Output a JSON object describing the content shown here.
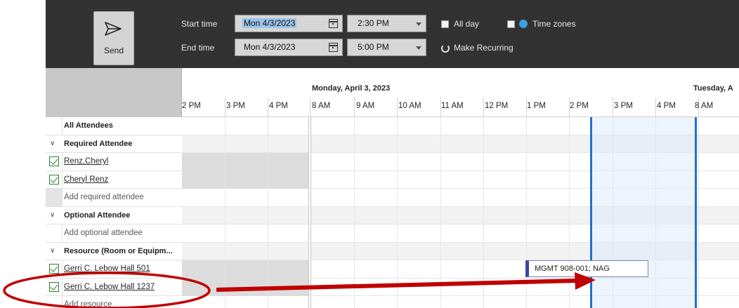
{
  "toolbar": {
    "send_label": "Send",
    "start_label": "Start time",
    "end_label": "End time",
    "start_date": "Mon 4/3/2023",
    "end_date": "Mon 4/3/2023",
    "start_time": "2:30 PM",
    "end_time": "5:00 PM",
    "all_day_label": "All day",
    "time_zones_label": "Time zones",
    "recurring_label": "Make Recurring"
  },
  "timeline": {
    "day1": "Monday, April 3, 2023",
    "day2": "Tuesday, A",
    "hours": [
      "2 PM",
      "3 PM",
      "4 PM",
      "8 AM",
      "9 AM",
      "10 AM",
      "11 AM",
      "12 PM",
      "1 PM",
      "2 PM",
      "3 PM",
      "4 PM",
      "8 AM"
    ]
  },
  "attendees": {
    "all": "All Attendees",
    "required_header": "Required Attendee",
    "required": [
      "Renz,Cheryl",
      "Cheryl Renz"
    ],
    "add_required": "Add required attendee",
    "optional_header": "Optional Attendee",
    "add_optional": "Add optional attendee",
    "resource_header": "Resource (Room or Equipm...",
    "resources": [
      "Gerri C. Lebow Hall 501",
      "Gerri C. Lebow Hall 1237"
    ],
    "add_resource": "Add resource"
  },
  "meeting": {
    "label": "MGMT 908-001; NAG"
  },
  "colors": {
    "toolbar_bg": "#323232",
    "selection_border": "#1f6fd1",
    "annotation": "#c00000"
  },
  "icons": [
    "send-icon",
    "calendar-icon",
    "chevron-down-icon",
    "checkbox-icon",
    "globe-icon",
    "recurring-icon",
    "checkmark-icon"
  ]
}
